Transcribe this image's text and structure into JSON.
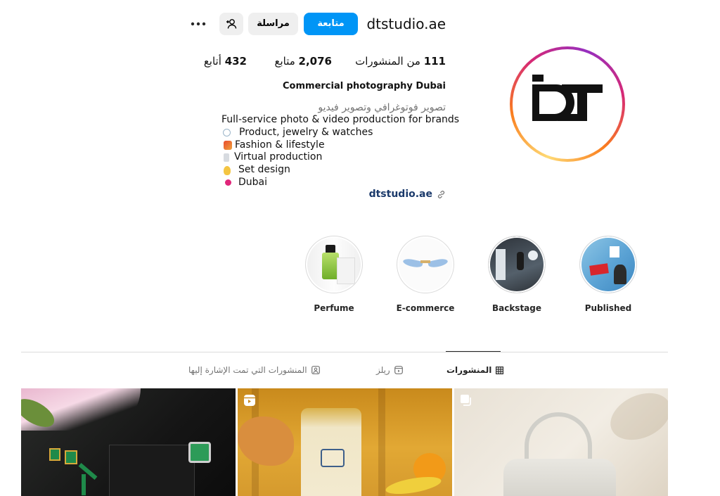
{
  "header": {
    "username": "dtstudio.ae",
    "follow_label": "متابعة",
    "message_label": "مراسلة"
  },
  "stats": {
    "posts": {
      "count": "111",
      "label": "من المنشورات"
    },
    "followers": {
      "count": "2,076",
      "label": "متابع"
    },
    "following": {
      "count": "432",
      "label": "أتابع"
    }
  },
  "bio": {
    "full_name": "Commercial photography Dubai",
    "category": "تصوير فوتوغرافي وتصوير فيديو",
    "lines": [
      "Full-service photo & video production for brands",
      "Product, jewelry & watches",
      "Fashion & lifestyle",
      "Virtual production",
      "Set design",
      "Dubai"
    ],
    "website": "dtstudio.ae"
  },
  "highlights": [
    {
      "label": "Perfume"
    },
    {
      "label": "E-commerce"
    },
    {
      "label": "Backstage"
    },
    {
      "label": "Published"
    }
  ],
  "tabs": {
    "posts": "المنشورات",
    "reels": "ريلز",
    "tagged": "المنشورات التي تمت الإشارة إليها"
  },
  "colors": {
    "accent": "#0095f6",
    "text": "#262626",
    "muted": "#737373",
    "link": "#1b3a6b"
  },
  "icons": {
    "options": "more-horizontal-icon",
    "suggest": "add-person-icon",
    "link": "link-icon",
    "posts_tab": "grid-icon",
    "reels_tab": "reels-icon",
    "tagged_tab": "tagged-person-icon"
  }
}
